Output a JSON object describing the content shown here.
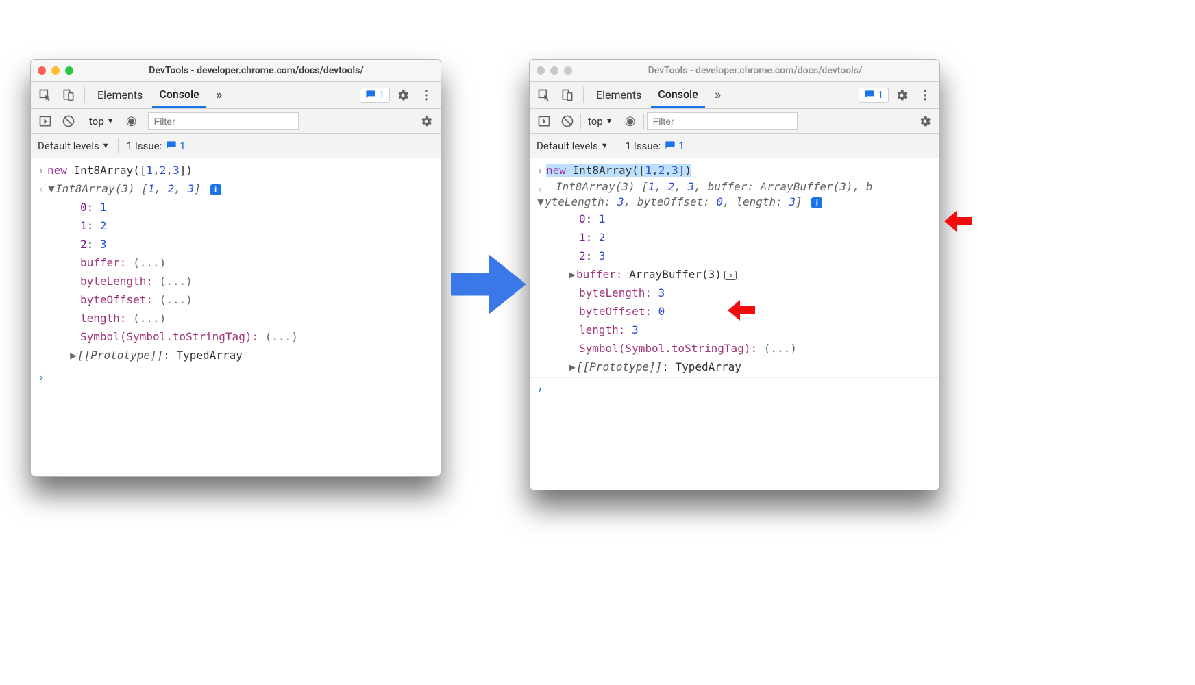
{
  "windows": {
    "left": {
      "title": "DevTools - developer.chrome.com/docs/devtools/",
      "traffic_active": true,
      "tabs": {
        "elements": "Elements",
        "console": "Console",
        "active": "Console"
      },
      "issues_count": "1",
      "filter_placeholder": "Filter",
      "context": "top",
      "levels_label": "Default levels",
      "issue_label": "1 Issue:",
      "issue_count": "1",
      "console": {
        "input": "new Int8Array([1,2,3])",
        "summary": "Int8Array(3) [1, 2, 3]",
        "entries": [
          {
            "key": "0",
            "val": "1"
          },
          {
            "key": "1",
            "val": "2"
          },
          {
            "key": "2",
            "val": "3"
          }
        ],
        "lazy_props": [
          "buffer",
          "byteLength",
          "byteOffset",
          "length"
        ],
        "symbol_prop": "Symbol(Symbol.toStringTag)",
        "proto_key": "[[Prototype]]",
        "proto_val": "TypedArray"
      }
    },
    "right": {
      "title": "DevTools - developer.chrome.com/docs/devtools/",
      "tabs": {
        "elements": "Elements",
        "console": "Console",
        "active": "Console"
      },
      "issues_count": "1",
      "filter_placeholder": "Filter",
      "context": "top",
      "levels_label": "Default levels",
      "issue_label": "1 Issue:",
      "issue_count": "1",
      "console": {
        "input": "new Int8Array([1,2,3])",
        "summary_line1": "Int8Array(3) [1, 2, 3, buffer: ArrayBuffer(3), b",
        "summary_line2": "yteLength: 3, byteOffset: 0, length: 3]",
        "entries": [
          {
            "key": "0",
            "val": "1"
          },
          {
            "key": "1",
            "val": "2"
          },
          {
            "key": "2",
            "val": "3"
          }
        ],
        "buffer_key": "buffer",
        "buffer_val": "ArrayBuffer(3)",
        "resolved_props": [
          {
            "key": "byteLength",
            "val": "3"
          },
          {
            "key": "byteOffset",
            "val": "0"
          },
          {
            "key": "length",
            "val": "3"
          }
        ],
        "symbol_prop": "Symbol(Symbol.toStringTag)",
        "symbol_val": "(...)",
        "proto_key": "[[Prototype]]",
        "proto_val": "TypedArray"
      }
    }
  }
}
